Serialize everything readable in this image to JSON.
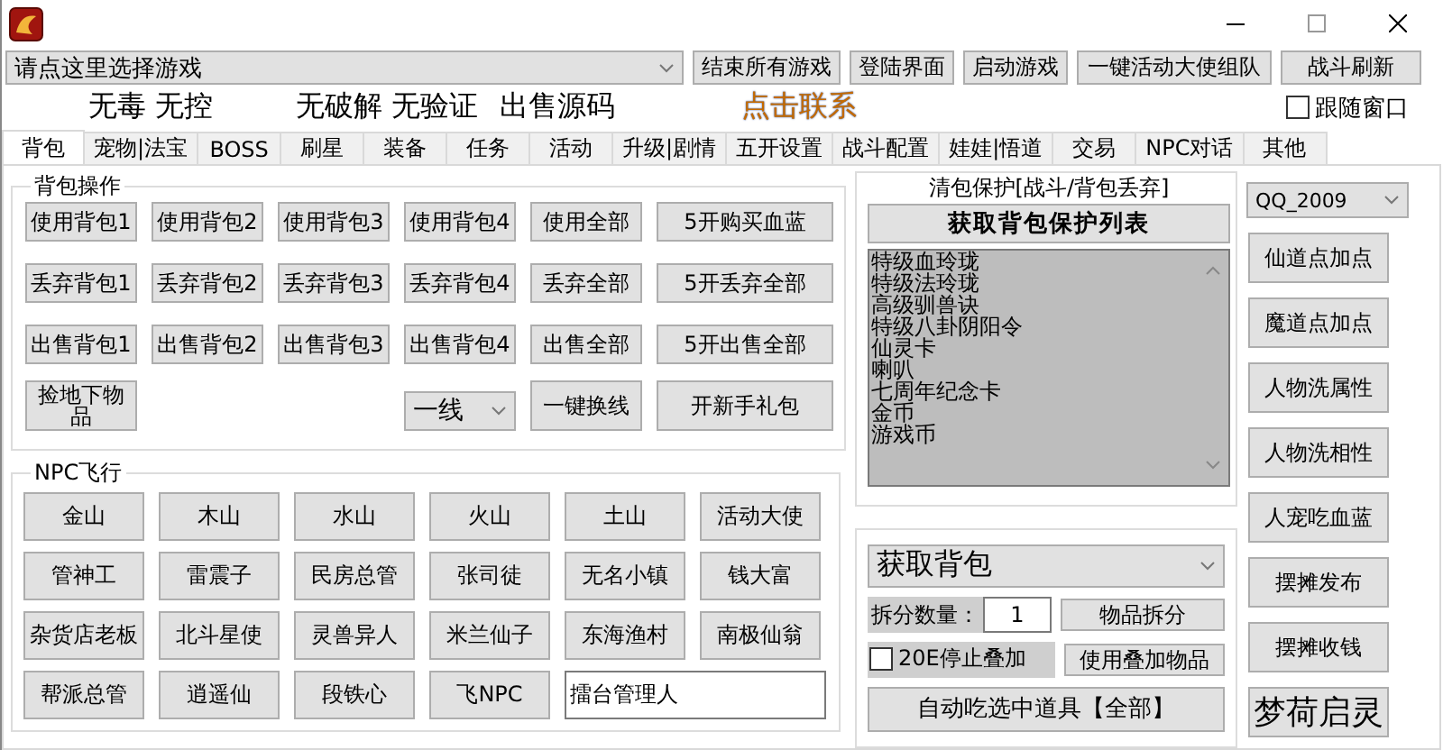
{
  "game_select": {
    "value": "请点这里选择游戏"
  },
  "top_buttons": [
    "结束所有游戏",
    "登陆界面",
    "启动游戏",
    "一键活动大使组队",
    "战斗刷新"
  ],
  "banner": [
    {
      "text": "无毒 无控",
      "kind": "plain"
    },
    {
      "text": "无破解 无验证",
      "kind": "plain"
    },
    {
      "text": "出售源码",
      "kind": "plain"
    },
    {
      "text": "点击联系",
      "kind": "link"
    }
  ],
  "follow_window": {
    "label": "跟随窗口",
    "checked": false
  },
  "tabs": [
    {
      "label": "背包",
      "selected": true
    },
    {
      "label": "宠物|法宝",
      "selected": false
    },
    {
      "label": "BOSS",
      "selected": false
    },
    {
      "label": "刷星",
      "selected": false
    },
    {
      "label": "装备",
      "selected": false
    },
    {
      "label": "任务",
      "selected": false
    },
    {
      "label": "活动",
      "selected": false
    },
    {
      "label": "升级|剧情",
      "selected": false
    },
    {
      "label": "五开设置",
      "selected": false
    },
    {
      "label": "战斗配置",
      "selected": false
    },
    {
      "label": "娃娃|悟道",
      "selected": false
    },
    {
      "label": "交易",
      "selected": false
    },
    {
      "label": "NPC对话",
      "selected": false
    },
    {
      "label": "其他",
      "selected": false
    }
  ],
  "bag_ops": {
    "title": "背包操作",
    "rows": [
      [
        "使用背包1",
        "使用背包2",
        "使用背包3",
        "使用背包4",
        "使用全部",
        "5开购买血蓝"
      ],
      [
        "丢弃背包1",
        "丢弃背包2",
        "丢弃背包3",
        "丢弃背包4",
        "丢弃全部",
        "5开丢弃全部"
      ],
      [
        "出售背包1",
        "出售背包2",
        "出售背包3",
        "出售背包4",
        "出售全部",
        "5开出售全部"
      ]
    ],
    "pickup_button": "捡地下物品",
    "line_select": {
      "value": "一线"
    },
    "buttons": [
      "一键换线",
      "开新手礼包"
    ]
  },
  "npc_flight": {
    "title": "NPC飞行",
    "buttons": [
      "金山",
      "木山",
      "水山",
      "火山",
      "土山",
      "活动大使",
      "管神工",
      "雷震子",
      "民房总管",
      "张司徒",
      "无名小镇",
      "钱大富",
      "杂货店老板",
      "北斗星使",
      "灵兽异人",
      "米兰仙子",
      "东海渔村",
      "南极仙翁",
      "帮派总管",
      "逍遥仙",
      "段铁心",
      "飞NPC"
    ],
    "input": {
      "value": "擂台管理人"
    }
  },
  "protect": {
    "title": "清包保护[战斗/背包丢弃]",
    "fetch_button": "获取背包保护列表",
    "items": [
      "特级血玲珑",
      "特级法玲珑",
      "高级驯兽诀",
      "特级八卦阴阳令",
      "仙灵卡",
      "喇叭",
      "七周年纪念卡",
      "金币",
      "游戏币"
    ]
  },
  "bag_tools": {
    "select": {
      "value": "获取背包"
    },
    "split_label": "拆分数量：",
    "split_count": "1",
    "split_button": "物品拆分",
    "stop_stack": {
      "label": "20E停止叠加",
      "checked": false
    },
    "use_stack_button": "使用叠加物品",
    "auto_eat_button": "自动吃选中道具【全部】"
  },
  "account_select": {
    "value": "QQ_2009"
  },
  "side_buttons": [
    "仙道点加点",
    "魔道点加点",
    "人物洗属性",
    "人物洗相性",
    "人宠吃血蓝",
    "摆摊发布",
    "摆摊收钱",
    "梦荷启灵"
  ]
}
